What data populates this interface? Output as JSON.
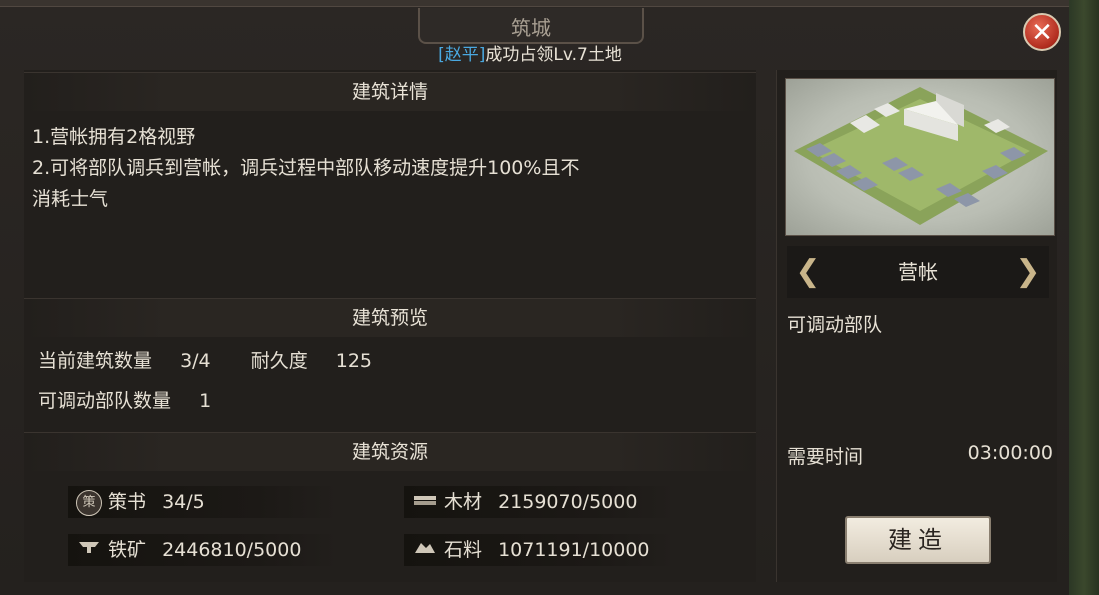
{
  "window": {
    "title": "筑城",
    "subtitle_player": "[赵平]",
    "subtitle_text": "成功占领Lv.7土地",
    "close_label": "✕"
  },
  "details": {
    "heading": "建筑详情",
    "line1": "1.营帐拥有2格视野",
    "line2": "2.可将部队调兵到营帐，调兵过程中部队移动速度提升100%且不",
    "line3": "消耗士气"
  },
  "preview": {
    "heading": "建筑预览",
    "count_label": "当前建筑数量",
    "count_value": "3/4",
    "durability_label": "耐久度",
    "durability_value": "125",
    "troops_label": "可调动部队数量",
    "troops_value": "1"
  },
  "resources": {
    "heading": "建筑资源",
    "items": [
      {
        "icon": "strategy-book-icon",
        "glyph": "策",
        "label": "策书",
        "value": "34/5"
      },
      {
        "icon": "wood-icon",
        "glyph": "",
        "label": "木材",
        "value": "2159070/5000"
      },
      {
        "icon": "iron-ore-icon",
        "glyph": "",
        "label": "铁矿",
        "value": "2446810/5000"
      },
      {
        "icon": "stone-icon",
        "glyph": "",
        "label": "石料",
        "value": "1071191/10000"
      }
    ]
  },
  "building": {
    "name": "营帐",
    "description": "可调动部队",
    "time_label": "需要时间",
    "time_value": "03:00:00",
    "build_label": "建造"
  },
  "colors": {
    "player_name": "#4aa8e0",
    "close_button": "#c0392b",
    "build_button": "#e8e1d3"
  }
}
